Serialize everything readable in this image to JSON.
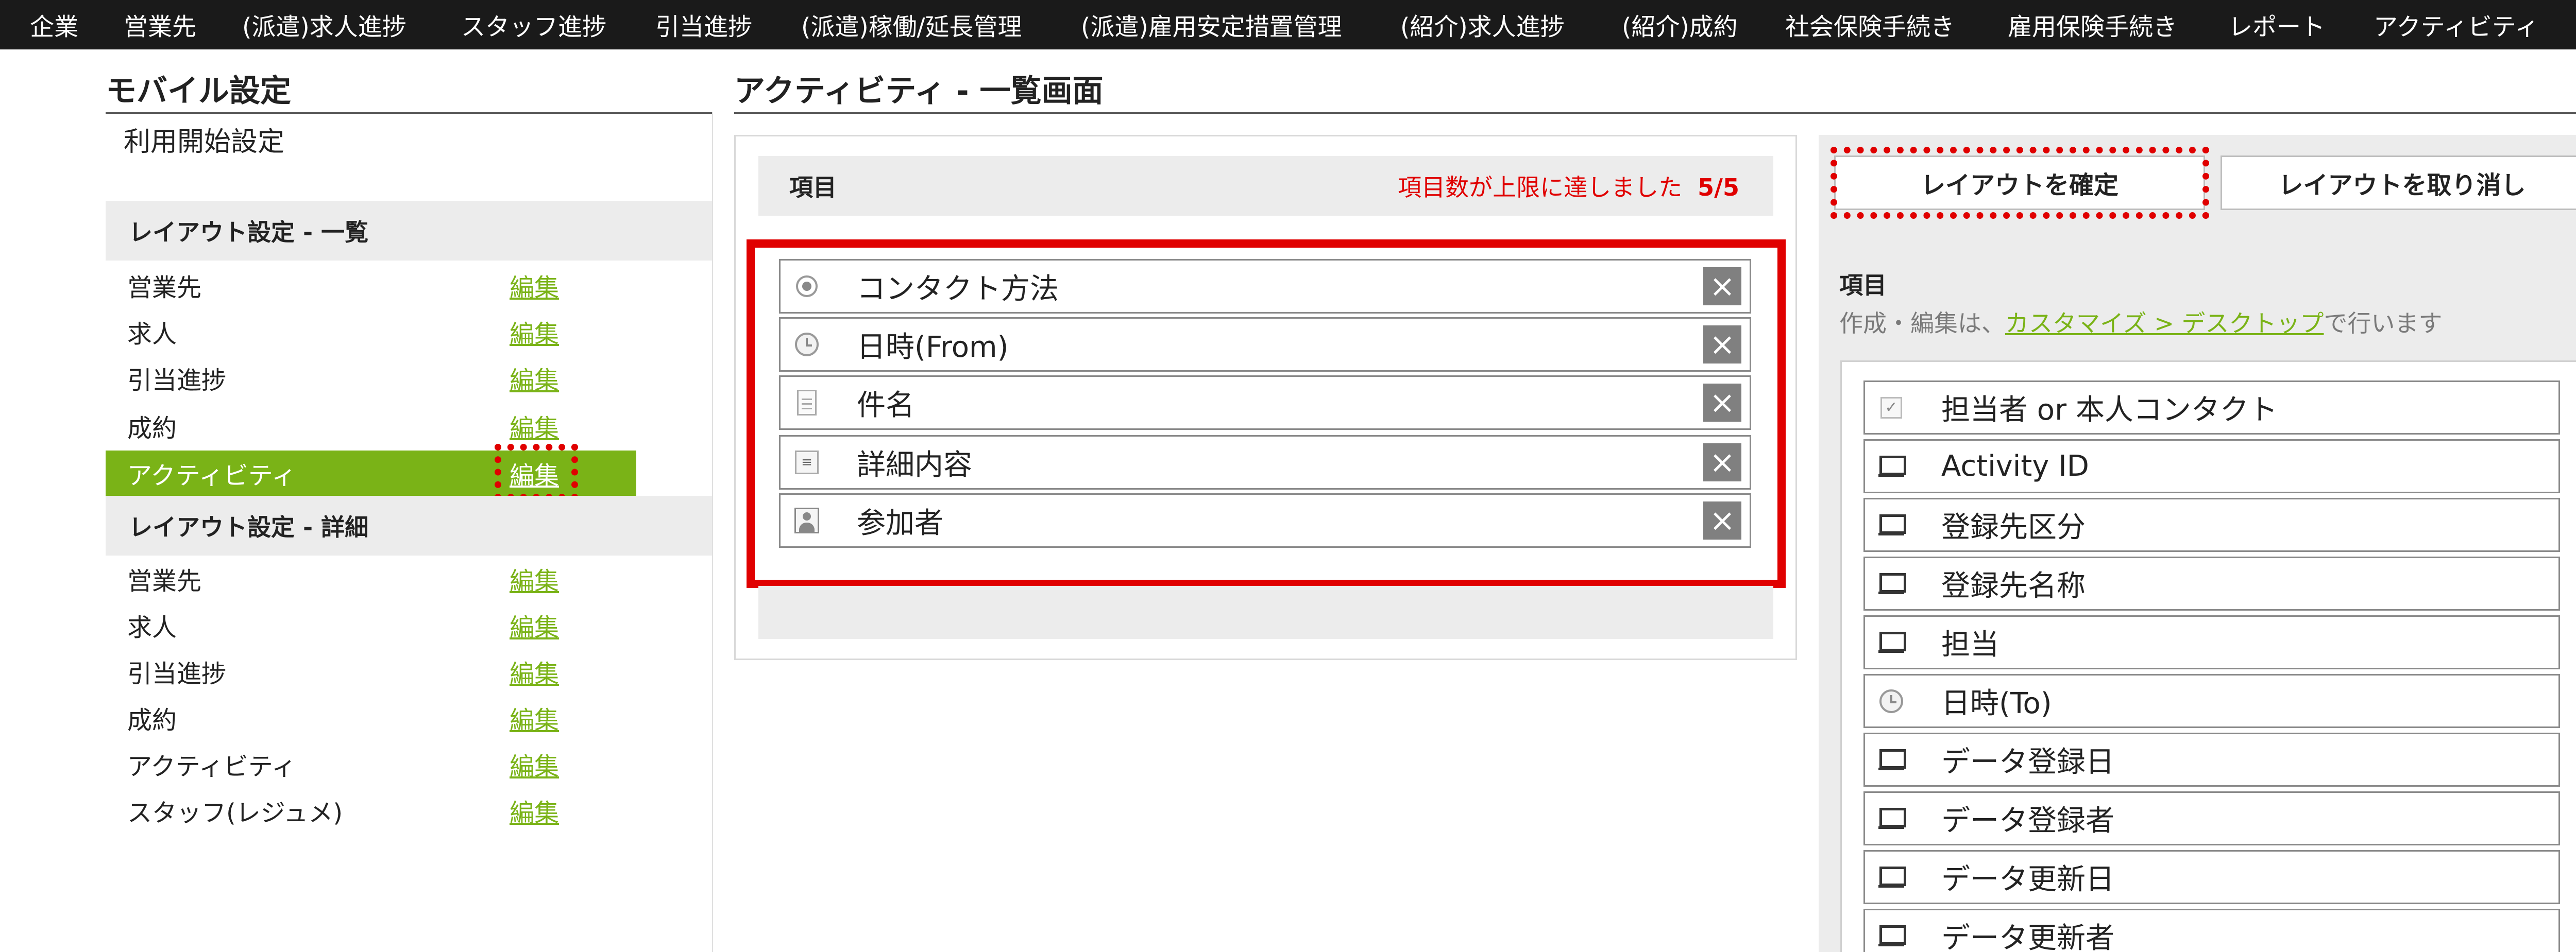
{
  "nav": {
    "items": [
      "企業",
      "営業先",
      "(派遣)求人進捗",
      "スタッフ進捗",
      "引当進捗",
      "(派遣)稼働/延長管理",
      "(派遣)雇用安定措置管理",
      "(紹介)求人進捗",
      "(紹介)成約",
      "社会保険手続き",
      "雇用保険手続き",
      "レポート",
      "アクティビティ"
    ]
  },
  "sidebar": {
    "title": "モバイル設定",
    "start_setting": "利用開始設定",
    "list_section": {
      "header": "レイアウト設定 - 一覧",
      "edit_label": "編集",
      "items": [
        "営業先",
        "求人",
        "引当進捗",
        "成約",
        "アクティビティ"
      ],
      "active_item": "アクティビティ"
    },
    "detail_section": {
      "header": "レイアウト設定 - 詳細",
      "edit_label": "編集",
      "items": [
        "営業先",
        "求人",
        "引当進捗",
        "成約",
        "アクティビティ",
        "スタッフ(レジュメ)"
      ]
    }
  },
  "main": {
    "title": "アクティビティ - 一覧画面",
    "panel": {
      "header": "項目",
      "limit_message": "項目数が上限に達しました",
      "count": "5/5",
      "selected_items": [
        {
          "label": "コンタクト方法",
          "icon": "radio-icon"
        },
        {
          "label": "日時(From)",
          "icon": "clock-icon"
        },
        {
          "label": "件名",
          "icon": "document-icon"
        },
        {
          "label": "詳細内容",
          "icon": "detail-icon"
        },
        {
          "label": "参加者",
          "icon": "person-icon"
        }
      ],
      "remove_glyph": "×"
    }
  },
  "right": {
    "confirm_button": "レイアウトを確定",
    "cancel_button": "レイアウトを取り消し",
    "label": "項目",
    "note_prefix": "作成・編集は、",
    "note_link": "カスタマイズ > デスクトップ",
    "note_suffix": "で行います",
    "fields": [
      {
        "label": "担当者 or 本人コンタクト",
        "icon": "checkbox-icon"
      },
      {
        "label": "Activity ID",
        "icon": "monitor-icon"
      },
      {
        "label": "登録先区分",
        "icon": "monitor-icon"
      },
      {
        "label": "登録先名称",
        "icon": "monitor-icon"
      },
      {
        "label": "担当",
        "icon": "monitor-icon"
      },
      {
        "label": "日時(To)",
        "icon": "clock-icon"
      },
      {
        "label": "データ登録日",
        "icon": "monitor-icon"
      },
      {
        "label": "データ登録者",
        "icon": "monitor-icon"
      },
      {
        "label": "データ更新日",
        "icon": "monitor-icon"
      },
      {
        "label": "データ更新者",
        "icon": "monitor-icon"
      }
    ]
  },
  "colors": {
    "accent_green": "#7ab317",
    "highlight_red": "#e00000",
    "nav_bg": "#1a1a1a"
  }
}
